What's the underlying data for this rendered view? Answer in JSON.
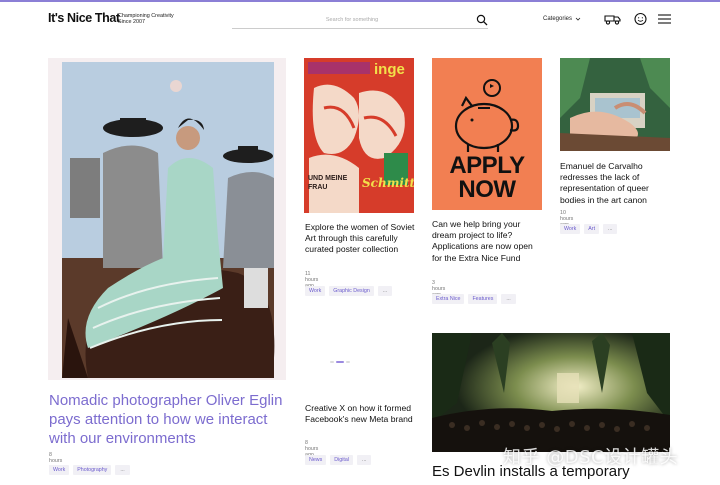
{
  "header": {
    "logo": "It's Nice That",
    "tagline_1": "Championing Creativity",
    "tagline_2": "Since 2007",
    "search_placeholder": "Search for something",
    "categories_label": "Categories"
  },
  "cards": [
    {
      "title": "Nomadic photographer Oliver Eglin pays attention to how we interact with our environments",
      "time": "8 hours ago",
      "tags": [
        "Work",
        "Photography",
        "..."
      ]
    },
    {
      "title": "Explore the women of Soviet Art through this carefully curated poster collection",
      "time": "11 hours ago",
      "tags": [
        "Work",
        "Graphic Design",
        "..."
      ],
      "poster_text_top": "inge",
      "poster_text_bottom_1": "UND MEINE",
      "poster_text_bottom_2": "FRAU",
      "poster_text_script": "Schmitt"
    },
    {
      "title": "Can we help bring your dream project to life? Applications are now open for the Extra Nice Fund",
      "time": "3 hours ago",
      "tags": [
        "Extra Nice",
        "Features",
        "..."
      ],
      "poster_line_1": "APPLY",
      "poster_line_2": "NOW"
    },
    {
      "title": "Emanuel de Carvalho redresses the lack of representation of queer bodies in the art canon",
      "time": "10 hours ago",
      "tags": [
        "Work",
        "Art",
        "..."
      ]
    },
    {
      "title": "Creative X on how it formed Facebook's new Meta brand",
      "time": "8 hours ago",
      "tags": [
        "News",
        "Digital",
        "..."
      ]
    },
    {
      "title": "Es Devlin installs a temporary"
    }
  ],
  "watermark": "知乎 @DSC设计罐头",
  "colors": {
    "accent": "#7c6ccf",
    "tag_text": "#6a5acd",
    "tag_bg": "#f1f0f5",
    "apply_bg": "#f27f52",
    "soviet_bg": "#d63c2a"
  }
}
